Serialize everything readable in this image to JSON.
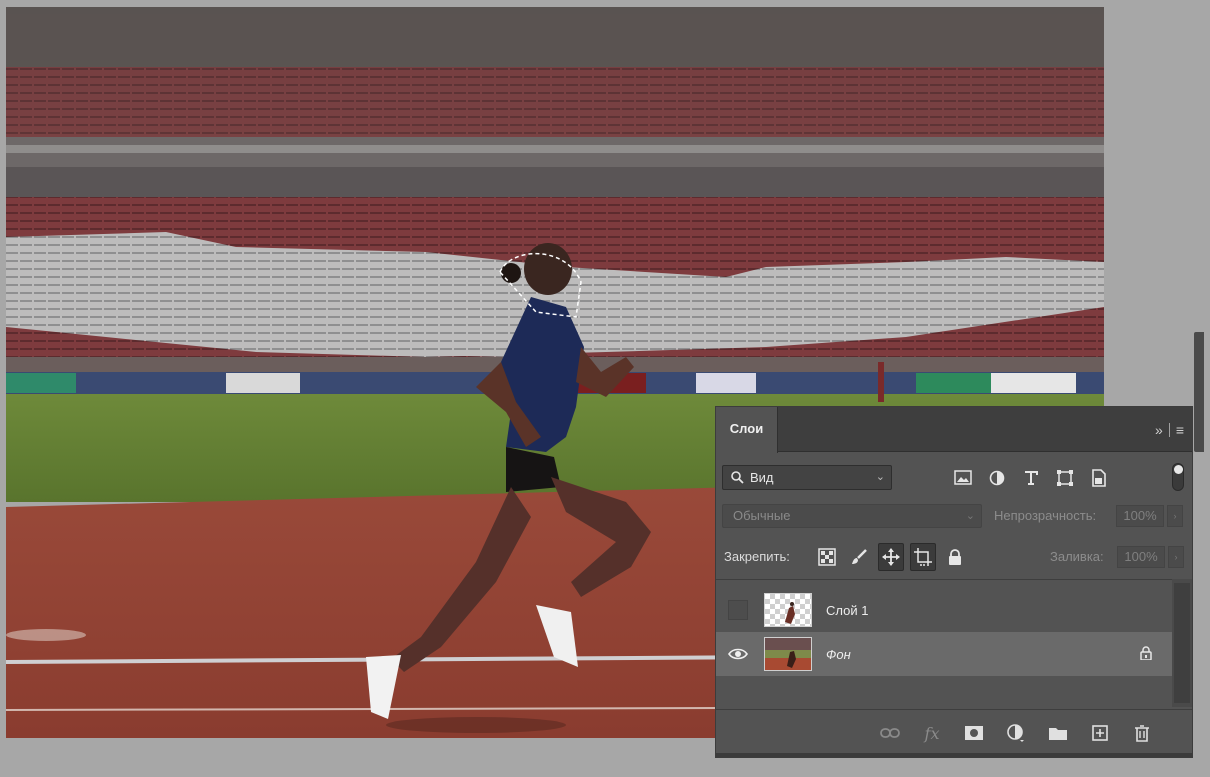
{
  "canvas": {
    "image_subject": "female runner on stadium track"
  },
  "layers_panel": {
    "tab_label": "Слои",
    "header_icons": [
      "collapse-icon",
      "panel-menu-icon"
    ],
    "collapse_glyph": "»",
    "menu_glyph": "≡",
    "filter": {
      "selected": "Вид",
      "icons": [
        "pixel-layer-filter-icon",
        "adjustment-filter-icon",
        "type-filter-icon",
        "shape-filter-icon",
        "smart-object-filter-icon"
      ]
    },
    "blend_mode": "Обычные",
    "opacity_label": "Непрозрачность:",
    "opacity_value": "100%",
    "lock_label": "Закрепить:",
    "lock_icons": [
      "lock-transparent-pixels-icon",
      "lock-image-pixels-icon",
      "lock-position-icon",
      "lock-artboard-icon",
      "lock-all-icon"
    ],
    "fill_label": "Заливка:",
    "fill_value": "100%",
    "layers": [
      {
        "name": "Слой 1",
        "visible": false,
        "selected": false,
        "locked": false,
        "italic": false
      },
      {
        "name": "Фон",
        "visible": true,
        "selected": true,
        "locked": true,
        "italic": true
      }
    ],
    "footer_icons": [
      "link-layers-icon",
      "fx-icon",
      "add-mask-icon",
      "adjustment-layer-icon",
      "new-group-icon",
      "new-layer-icon",
      "delete-layer-icon"
    ]
  },
  "colors": {
    "panel_bg": "#535353",
    "panel_header_bg": "#3e3e3e",
    "selected_layer_bg": "#6a6a6a",
    "workspace_bg": "#a7a7a7"
  }
}
